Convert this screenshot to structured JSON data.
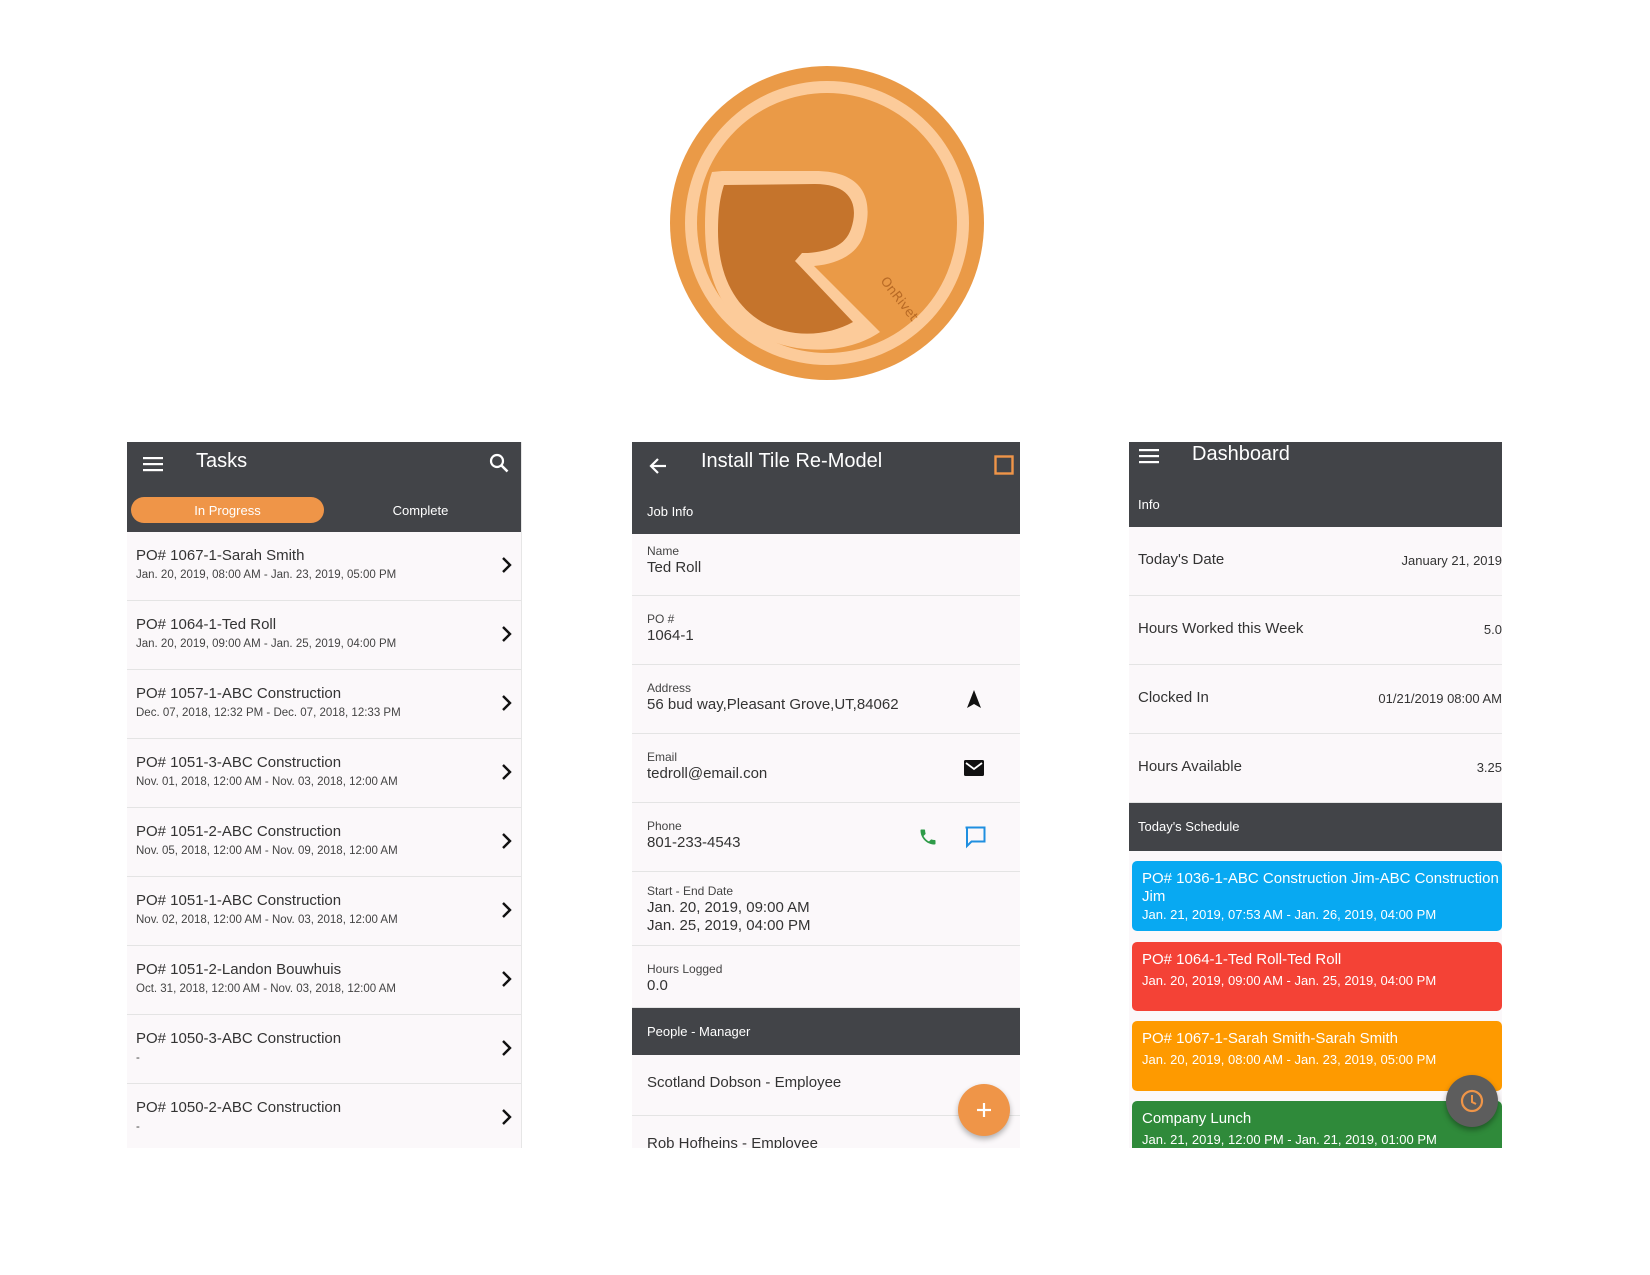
{
  "colors": {
    "accent": "#ef9548",
    "appbar": "#424448",
    "schedule_blue": "#08a9f2",
    "schedule_red": "#f44236",
    "schedule_orange": "#fe9a00",
    "schedule_green": "#2f8a3a"
  },
  "logo": {
    "text": "OnRivet"
  },
  "tasks": {
    "title": "Tasks",
    "tabs": [
      {
        "label": "In Progress",
        "active": true
      },
      {
        "label": "Complete",
        "active": false
      }
    ],
    "items": [
      {
        "title": "PO# 1067-1-Sarah Smith",
        "dates": "Jan. 20, 2019, 08:00 AM - Jan. 23, 2019, 05:00 PM"
      },
      {
        "title": "PO# 1064-1-Ted Roll",
        "dates": "Jan. 20, 2019, 09:00 AM - Jan. 25, 2019, 04:00 PM"
      },
      {
        "title": "PO# 1057-1-ABC Construction",
        "dates": "Dec. 07, 2018, 12:32 PM - Dec. 07, 2018, 12:33 PM"
      },
      {
        "title": "PO# 1051-3-ABC Construction",
        "dates": "Nov. 01, 2018, 12:00 AM - Nov. 03, 2018, 12:00 AM"
      },
      {
        "title": "PO# 1051-2-ABC Construction",
        "dates": "Nov. 05, 2018, 12:00 AM - Nov. 09, 2018, 12:00 AM"
      },
      {
        "title": "PO# 1051-1-ABC Construction",
        "dates": "Nov. 02, 2018, 12:00 AM - Nov. 03, 2018, 12:00 AM"
      },
      {
        "title": "PO# 1051-2-Landon Bouwhuis",
        "dates": "Oct. 31, 2018, 12:00 AM - Nov. 03, 2018, 12:00 AM"
      },
      {
        "title": "PO# 1050-3-ABC Construction",
        "dates": "-"
      },
      {
        "title": "PO# 1050-2-ABC Construction",
        "dates": "-"
      }
    ]
  },
  "detail": {
    "title": "Install Tile Re-Model",
    "job_info_header": "Job Info",
    "name_label": "Name",
    "name_value": "Ted Roll",
    "po_label": "PO #",
    "po_value": "1064-1",
    "address_label": "Address",
    "address_value": "56 bud way,Pleasant Grove,UT,84062",
    "email_label": "Email",
    "email_value": "tedroll@email.con",
    "phone_label": "Phone",
    "phone_value": "801-233-4543",
    "dates_label": "Start - End Date",
    "start_value": "Jan. 20, 2019, 09:00 AM",
    "end_value": "Jan. 25, 2019, 04:00 PM",
    "hours_label": "Hours Logged",
    "hours_value": "0.0",
    "people_header": "People - Manager",
    "people": [
      "Scotland Dobson - Employee",
      "Rob Hofheins - Employee"
    ],
    "fab_icon": "plus-icon"
  },
  "dashboard": {
    "title": "Dashboard",
    "info_header": "Info",
    "info_rows": [
      {
        "label": "Today's Date",
        "value": "January 21, 2019"
      },
      {
        "label": "Hours Worked this Week",
        "value": "5.0"
      },
      {
        "label": "Clocked In",
        "value": "01/21/2019 08:00 AM"
      },
      {
        "label": "Hours Available",
        "value": "3.25"
      }
    ],
    "schedule_header": "Today's Schedule",
    "schedule": [
      {
        "title": "PO# 1036-1-ABC Construction Jim-ABC Construction",
        "title2": "Jim",
        "dates": "Jan. 21, 2019, 07:53 AM - Jan. 26, 2019, 04:00 PM"
      },
      {
        "title": "PO# 1064-1-Ted Roll-Ted Roll",
        "dates": "Jan. 20, 2019, 09:00 AM - Jan. 25, 2019, 04:00 PM"
      },
      {
        "title": "PO# 1067-1-Sarah Smith-Sarah Smith",
        "dates": "Jan. 20, 2019, 08:00 AM - Jan. 23, 2019, 05:00 PM"
      },
      {
        "title": "Company Lunch",
        "dates": "Jan. 21, 2019, 12:00 PM - Jan. 21, 2019, 01:00 PM"
      }
    ],
    "fab_icon": "clock-icon"
  }
}
